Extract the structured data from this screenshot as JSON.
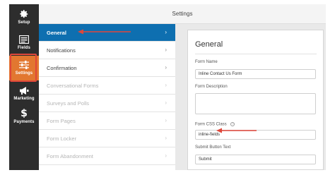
{
  "topbar": {
    "title": "Settings"
  },
  "leftnav": {
    "items": [
      {
        "label": "Setup",
        "icon": "gear-icon"
      },
      {
        "label": "Fields",
        "icon": "fields-list-icon"
      },
      {
        "label": "Settings",
        "icon": "sliders-icon"
      },
      {
        "label": "Marketing",
        "icon": "megaphone-icon"
      },
      {
        "label": "Payments",
        "icon": "dollar-icon"
      }
    ],
    "active": "Settings",
    "active_color": "#e27730"
  },
  "menu": {
    "items": [
      {
        "label": "General",
        "state": "active"
      },
      {
        "label": "Notifications",
        "state": "normal"
      },
      {
        "label": "Confirmation",
        "state": "normal"
      },
      {
        "label": "Conversational Forms",
        "state": "disabled"
      },
      {
        "label": "Surveys and Polls",
        "state": "disabled"
      },
      {
        "label": "Form Pages",
        "state": "disabled"
      },
      {
        "label": "Form Locker",
        "state": "disabled"
      },
      {
        "label": "Form Abandonment",
        "state": "disabled"
      }
    ],
    "chevron": "›",
    "active_color": "#0e6fb0"
  },
  "panel": {
    "title": "General",
    "form_name": {
      "label": "Form Name",
      "value": "Inline Contact Us Form"
    },
    "form_description": {
      "label": "Form Description",
      "value": ""
    },
    "form_css_class": {
      "label": "Form CSS Class",
      "help": "?",
      "value": "inline-fields"
    },
    "submit_button_text": {
      "label": "Submit Button Text",
      "value": "Submit"
    }
  },
  "annotations": {
    "arrow_color": "#e0473a"
  }
}
